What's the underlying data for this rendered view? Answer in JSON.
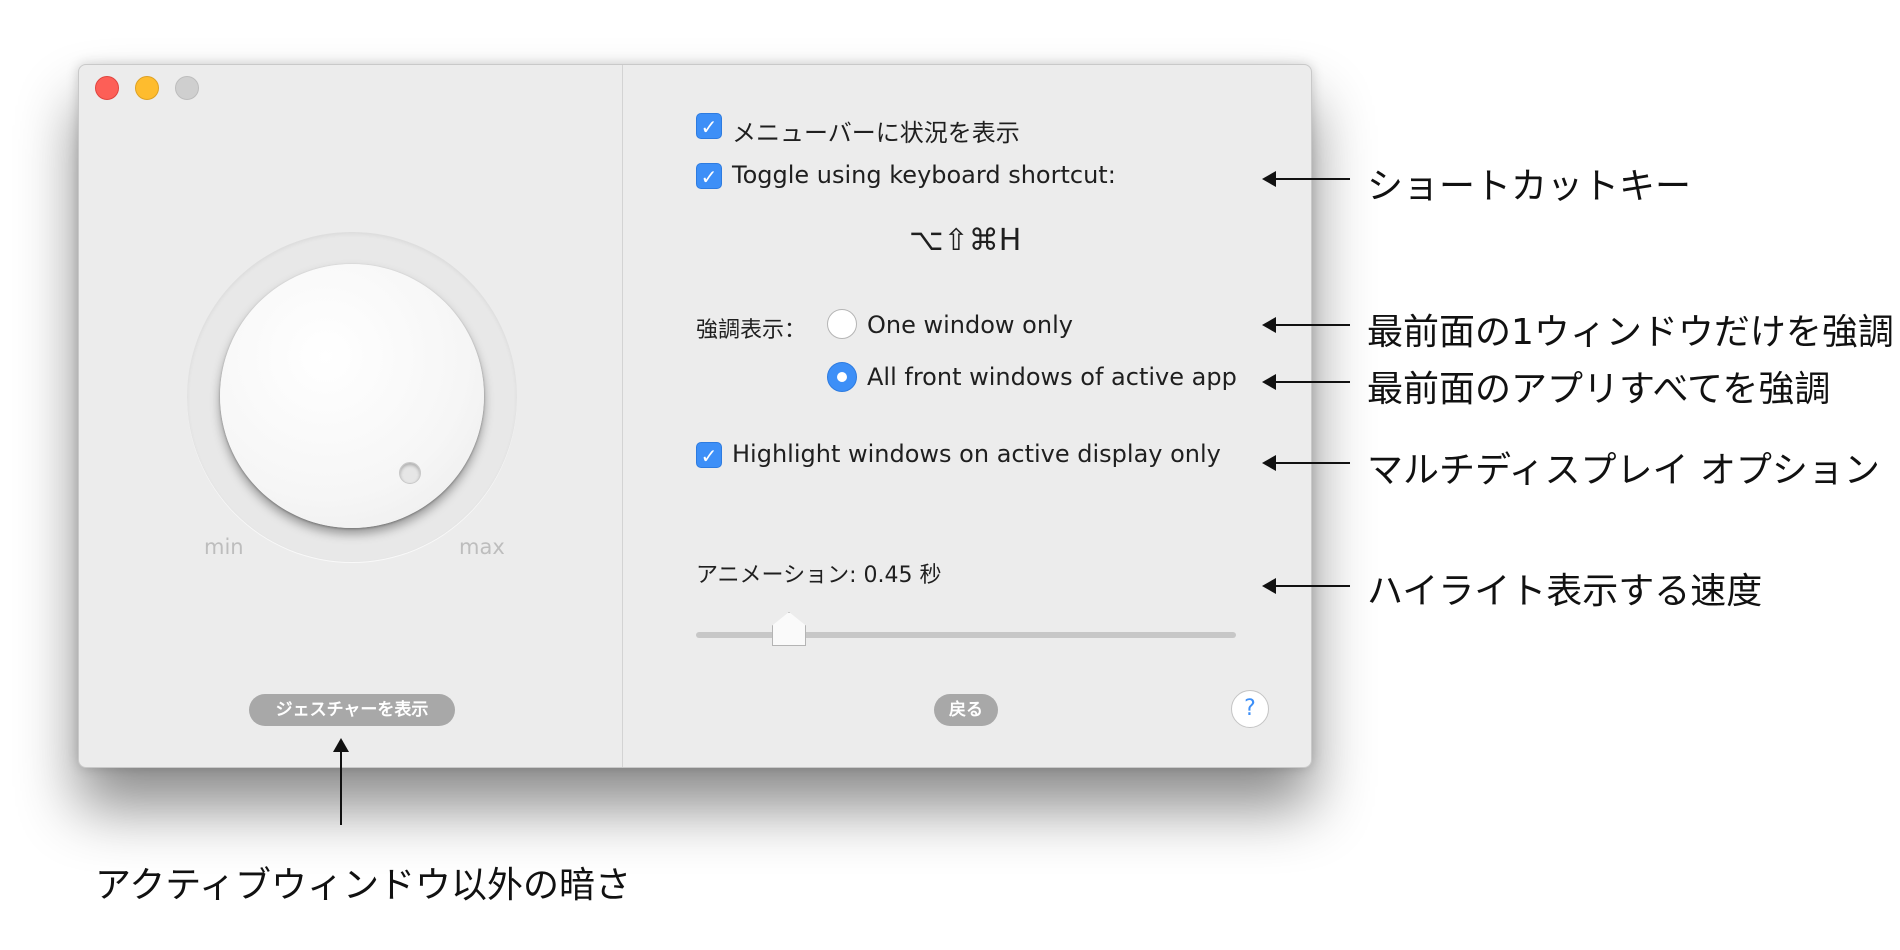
{
  "left_panel": {
    "dial_min_label": "min",
    "dial_max_label": "max",
    "gesture_button_label": "ジェスチャーを表示"
  },
  "right_panel": {
    "menubar_checkbox": {
      "label": "メニューバーに状況を表示",
      "checked": true
    },
    "shortcut_checkbox": {
      "label": "Toggle using keyboard shortcut:",
      "checked": true
    },
    "shortcut_keys": "⌥⇧⌘H",
    "highlight_label": "強調表示：",
    "highlight_options": [
      {
        "label": "One window only",
        "selected": false
      },
      {
        "label": "All front windows of active app",
        "selected": true
      }
    ],
    "active_display_checkbox": {
      "label": "Highlight windows on active display only",
      "checked": true
    },
    "animation_label": "アニメーション: 0.45 秒",
    "animation_seconds": 0.45,
    "back_button_label": "戻る",
    "help_button_label": "?"
  },
  "annotations": {
    "shortcut": "ショートカットキー",
    "one_window": "最前面の1ウィンドウだけを強調",
    "all_windows": "最前面のアプリすべてを強調",
    "multi_display": "マルチディスプレイ オプション",
    "speed": "ハイライト表示する速度",
    "darkness": "アクティブウィンドウ以外の暗さ"
  },
  "colors": {
    "accent": "#3d8ff7",
    "close": "#fd5f57",
    "minimize": "#febc2e",
    "zoom_inactive": "#cfcfcf",
    "window_bg": "#ececec"
  }
}
